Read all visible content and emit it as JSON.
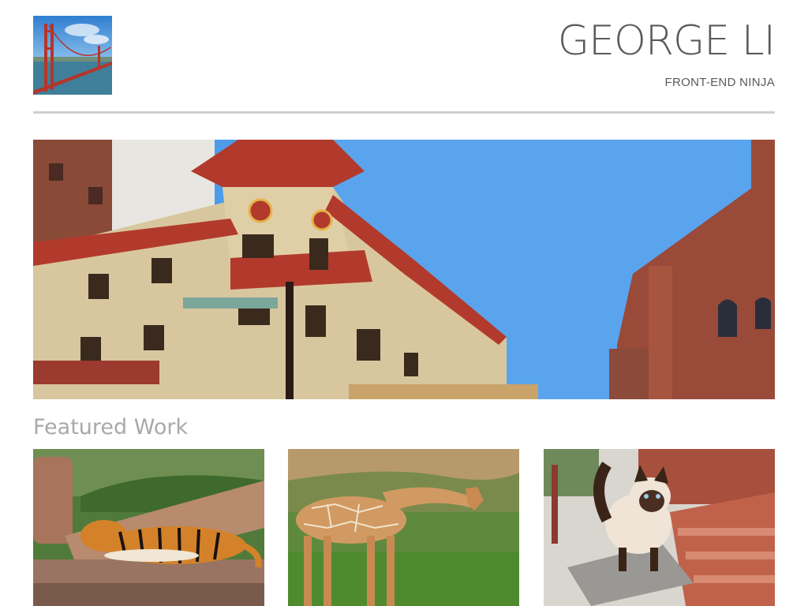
{
  "site": {
    "name": "GEORGE LI",
    "tagline": "FRONT-END NINJA"
  },
  "featured": {
    "title": "Featured Work",
    "items": [
      {
        "subject": "tiger"
      },
      {
        "subject": "giraffe"
      },
      {
        "subject": "cat"
      }
    ]
  }
}
